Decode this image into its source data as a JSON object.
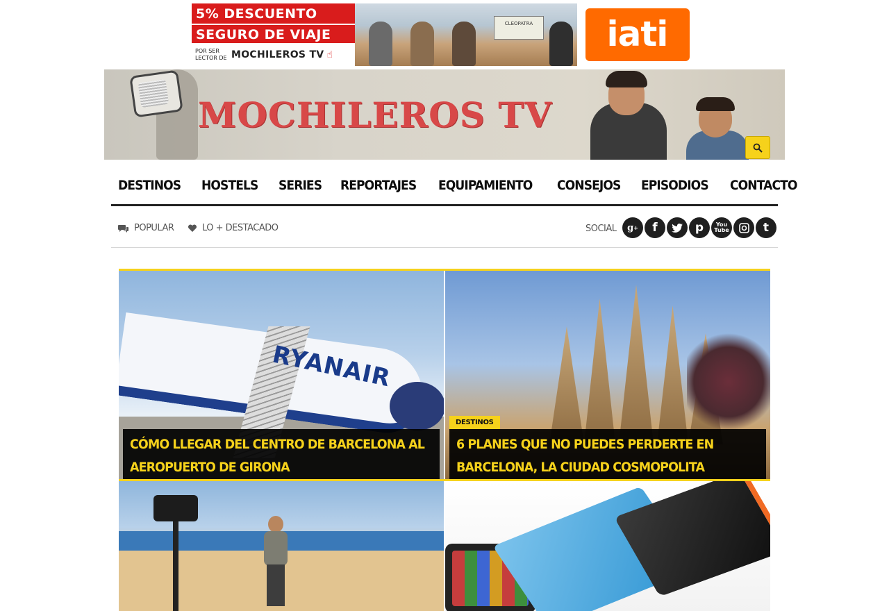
{
  "ad": {
    "line1": "5% DESCUENTO",
    "line2": "SEGURO DE VIAJE",
    "small_text_1": "POR SER",
    "small_text_2": "LECTOR DE",
    "brand": "MOCHILEROS TV",
    "sign_text": "CLEOPATRA",
    "partner_logo": "iati"
  },
  "header": {
    "logo_text": "MOCHILEROS TV",
    "search_icon": "search-icon"
  },
  "nav": {
    "items": [
      "DESTINOS",
      "HOSTELS",
      "SERIES",
      "REPORTAJES",
      "EQUIPAMIENTO",
      "CONSEJOS",
      "EPISODIOS",
      "CONTACTO"
    ]
  },
  "subbar": {
    "popular_label": "POPULAR",
    "featured_label": "LO + DESTACADO",
    "social_label": "SOCIAL",
    "social_icons": [
      "google-plus-icon",
      "facebook-icon",
      "twitter-icon",
      "pinterest-icon",
      "youtube-icon",
      "instagram-icon",
      "tumblr-icon"
    ]
  },
  "articles": [
    {
      "title": "CÓMO LLEGAR DEL CENTRO DE BARCELONA AL AEROPUERTO DE GIRONA",
      "category": ""
    },
    {
      "title": "6 PLANES QUE NO PUEDES PERDERTE EN BARCELONA, LA CIUDAD COSMOPOLITA",
      "category": "DESTINOS"
    }
  ],
  "colors": {
    "accent": "#f6d21b",
    "nav_text": "#0d0d0d",
    "ad_red": "#d91c1c",
    "iati_orange": "#ff6a00"
  }
}
